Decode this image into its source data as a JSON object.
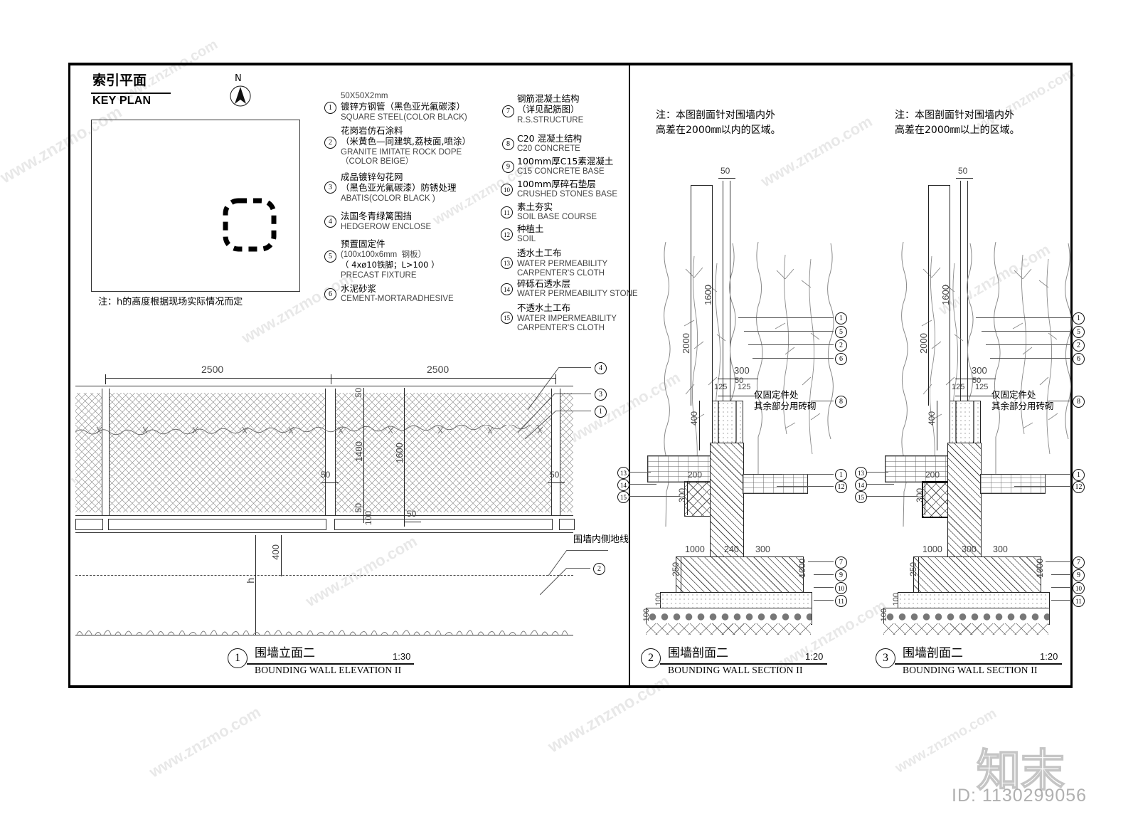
{
  "sheet": {
    "key_plan": {
      "title_cn": "索引平面",
      "title_en": "KEY PLAN",
      "north_label": "N",
      "note": "注：h的高度根据现场实际情况而定"
    },
    "legend_col1": [
      {
        "num": "1",
        "lines": [
          "50X50X2mm",
          "镀锌方钢管（黑色亚光氟碳漆）",
          "SQUARE STEEL(COLOR BLACK)"
        ]
      },
      {
        "num": "2",
        "lines": [
          "花岗岩仿石涂料",
          "（米黄色—同建筑,荔枝面,喷涂）",
          "GRANITE IMITATE ROCK DOPE",
          "（COLOR BEIGE）"
        ]
      },
      {
        "num": "3",
        "lines": [
          "成品镀锌勾花网",
          "（黑色亚光氟碳漆）防锈处理",
          "ABATIS(COLOR BLACK )"
        ]
      },
      {
        "num": "4",
        "lines": [
          "法国冬青绿篱围挡",
          "HEDGEROW ENCLOSE"
        ]
      },
      {
        "num": "5",
        "lines": [
          "预置固定件",
          "(100x100x6mm  钢板）",
          "（ 4xø10铁脚；L>100 ）",
          "PRECAST FIXTURE"
        ]
      },
      {
        "num": "6",
        "lines": [
          "水泥砂浆",
          "CEMENT-MORTARADHESIVE"
        ]
      }
    ],
    "legend_col2": [
      {
        "num": "7",
        "lines": [
          "钢筋混凝土结构",
          "（详见配筋图）",
          "R.S.STRUCTURE"
        ]
      },
      {
        "num": "8",
        "lines": [
          "C20 混凝土结构",
          "C20 CONCRETE"
        ]
      },
      {
        "num": "9",
        "lines": [
          "100mm厚C15素混凝土",
          "C15 CONCRETE BASE"
        ]
      },
      {
        "num": "10",
        "lines": [
          "100mm厚碎石垫层",
          "CRUSHED STONES BASE"
        ]
      },
      {
        "num": "11",
        "lines": [
          "素土夯实",
          "SOIL BASE COURSE"
        ]
      },
      {
        "num": "12",
        "lines": [
          "种植土",
          "SOIL"
        ]
      },
      {
        "num": "13",
        "lines": [
          "透水土工布",
          "WATER PERMEABILITY",
          "CARPENTER'S CLOTH"
        ]
      },
      {
        "num": "14",
        "lines": [
          "碎砾石透水层",
          "WATER PERMEABILITY STONE"
        ]
      },
      {
        "num": "15",
        "lines": [
          "不透水土工布",
          "WATER IMPERMEABILITY",
          "CARPENTER'S CLOTH"
        ]
      }
    ],
    "notes": {
      "section2": [
        "注：本图剖面针对围墙内外",
        "高差在2000㎜以内的区域。"
      ],
      "section3": [
        "注：本图剖面针对围墙内外",
        "高差在2000㎜以上的区域。"
      ]
    },
    "elevation": {
      "title_cn": "围墙立面二",
      "title_en": "BOUNDING WALL ELEVATION II",
      "number": "1",
      "scale": "1:30",
      "dims": {
        "bay_left": "2500",
        "bay_right": "2500",
        "mesh_height": "1400",
        "panel_height": "1600",
        "top_gap": "50",
        "bottom_gap": "50",
        "rail": "100",
        "post_width_a": "50",
        "post_width_b": "50",
        "post_width_c": "50",
        "base_to_ground": "400",
        "h": "h"
      },
      "labels": {
        "inner_ground_line": "围墙内侧地线",
        "callout_4": "4",
        "callout_3": "3",
        "callout_1": "1",
        "callout_2": "2"
      }
    },
    "section2": {
      "title_cn": "围墙剖面二",
      "title_en": "BOUNDING WALL SECTION II",
      "number": "2",
      "scale": "1:20",
      "note_fixture": [
        "仅固定件处",
        "其余部分用砖砌"
      ],
      "dims": [
        "50",
        "2000",
        "1600",
        "300",
        "50",
        "125",
        "125",
        "400",
        "200",
        "300",
        "1000",
        "240",
        "300",
        "1000",
        "250",
        "100",
        "100"
      ],
      "callouts_right_upper": [
        "1",
        "5",
        "2",
        "6"
      ],
      "callout_brick": "8",
      "callouts_right_mid": [
        "1",
        "12"
      ],
      "callouts_right_lower": [
        "7",
        "9",
        "10",
        "11"
      ],
      "callouts_left": [
        "13",
        "14",
        "15"
      ]
    },
    "section3": {
      "title_cn": "围墙剖面二",
      "title_en": "BOUNDING WALL SECTION II",
      "number": "3",
      "scale": "1:20",
      "note_fixture": [
        "仅固定件处",
        "其余部分用砖砌"
      ],
      "dims": [
        "50",
        "2000",
        "1600",
        "300",
        "50",
        "125",
        "125",
        "400",
        "200",
        "300",
        "1000",
        "300",
        "300",
        "1000",
        "250",
        "100",
        "100"
      ],
      "callouts_right_upper": [
        "1",
        "5",
        "2",
        "6"
      ],
      "callout_brick": "8",
      "callouts_right_mid": [
        "1",
        "12"
      ],
      "callouts_right_lower": [
        "7",
        "9",
        "10",
        "11"
      ],
      "callouts_left": [
        "13",
        "14",
        "15"
      ]
    },
    "watermarks": {
      "tile_text": "www.znzmo.com",
      "logo_cn": "知末",
      "id_text": "ID: 1130299056"
    }
  }
}
